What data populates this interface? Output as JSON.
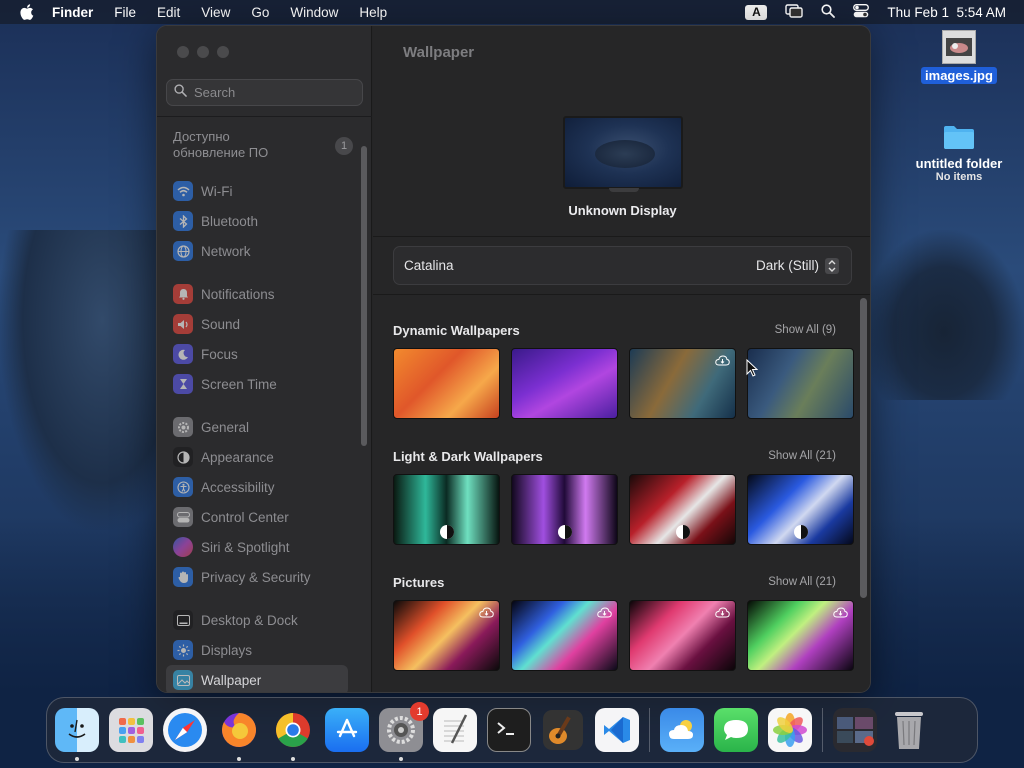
{
  "menubar": {
    "app_name": "Finder",
    "items": [
      "File",
      "Edit",
      "View",
      "Go",
      "Window",
      "Help"
    ],
    "input_indicator": "A",
    "datetime": "Thu Feb 1  5:54 AM"
  },
  "sidebar": {
    "search_placeholder": "Search",
    "update_text": "Доступно обновление ПО",
    "update_badge": "1",
    "items": [
      {
        "label": "Wi-Fi",
        "icon": "wifi-icon",
        "color": "#2f7ae5"
      },
      {
        "label": "Bluetooth",
        "icon": "bluetooth-icon",
        "color": "#2f7ae5"
      },
      {
        "label": "Network",
        "icon": "globe-icon",
        "color": "#2f7ae5"
      },
      {
        "label": "Notifications",
        "icon": "bell-icon",
        "color": "#e5483f"
      },
      {
        "label": "Sound",
        "icon": "speaker-icon",
        "color": "#e5483f"
      },
      {
        "label": "Focus",
        "icon": "moon-icon",
        "color": "#5e5ce6"
      },
      {
        "label": "Screen Time",
        "icon": "hourglass-icon",
        "color": "#5e5ce6"
      },
      {
        "label": "General",
        "icon": "gear-icon",
        "color": "#8e8e93"
      },
      {
        "label": "Appearance",
        "icon": "appearance-icon",
        "color": "#1c1c1e"
      },
      {
        "label": "Accessibility",
        "icon": "accessibility-icon",
        "color": "#2f7ae5"
      },
      {
        "label": "Control Center",
        "icon": "control-center-icon",
        "color": "#8e8e93"
      },
      {
        "label": "Siri & Spotlight",
        "icon": "siri-icon",
        "color": "#b44fd6"
      },
      {
        "label": "Privacy & Security",
        "icon": "hand-icon",
        "color": "#2f7ae5"
      },
      {
        "label": "Desktop & Dock",
        "icon": "desktop-dock-icon",
        "color": "#1c1c1e"
      },
      {
        "label": "Displays",
        "icon": "sun-icon",
        "color": "#2f7ae5"
      },
      {
        "label": "Wallpaper",
        "icon": "wallpaper-icon",
        "color": "#35a8d9"
      }
    ]
  },
  "main": {
    "title": "Wallpaper",
    "display_name": "Unknown Display",
    "selector": {
      "wallpaper": "Catalina",
      "mode": "Dark (Still)"
    },
    "sections": [
      {
        "title": "Dynamic Wallpapers",
        "show_all": "Show All (9)"
      },
      {
        "title": "Light & Dark Wallpapers",
        "show_all": "Show All (21)"
      },
      {
        "title": "Pictures",
        "show_all": "Show All (21)"
      }
    ]
  },
  "desktop": {
    "file_name": "images.jpg",
    "folder_name": "untitled folder",
    "folder_sub": "No items"
  },
  "dock": {
    "apps": [
      "Finder",
      "Launchpad",
      "Safari",
      "Firefox",
      "Chrome",
      "App Store",
      "System Settings",
      "TextEdit",
      "Terminal",
      "GarageBand",
      "Visual Studio Code",
      "Weather",
      "Messages",
      "Photos",
      "Screenshot",
      "Trash"
    ],
    "settings_badge": "1"
  }
}
